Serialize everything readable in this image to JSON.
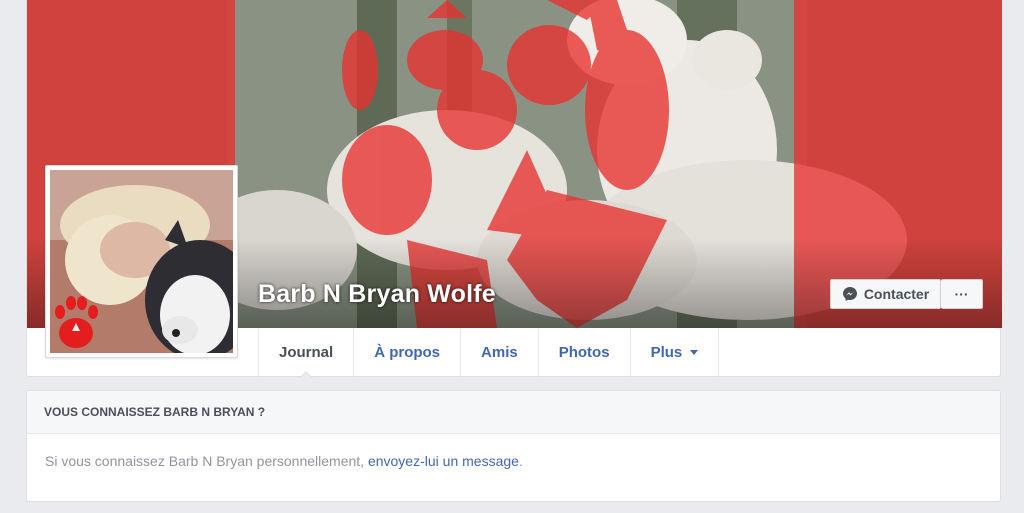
{
  "profile": {
    "name": "Barb N Bryan Wolfe"
  },
  "actions": {
    "contact_label": "Contacter",
    "more_label": "···"
  },
  "nav": {
    "tabs": [
      {
        "label": "Journal",
        "active": true
      },
      {
        "label": "À propos"
      },
      {
        "label": "Amis"
      },
      {
        "label": "Photos"
      },
      {
        "label": "Plus"
      }
    ]
  },
  "know_card": {
    "header": "VOUS CONNAISSEZ BARB N BRYAN ?",
    "body_text": "Si vous connaissez Barb N Bryan personnellement, ",
    "link_text": "envoyez-lui un message",
    "end_text": "."
  },
  "colors": {
    "link": "#4267b2",
    "canada_red": "#e8312f",
    "page_bg": "#e9ebee"
  }
}
